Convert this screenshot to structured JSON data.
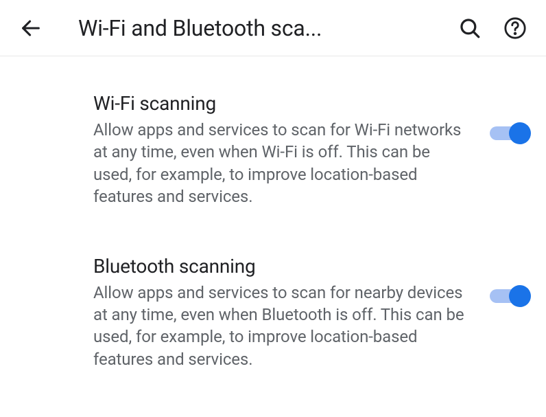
{
  "header": {
    "title": "Wi-Fi and Bluetooth sca..."
  },
  "settings": {
    "wifi": {
      "title": "Wi-Fi scanning",
      "description": "Allow apps and services to scan for Wi-Fi networks at any time, even when Wi-Fi is off. This can be used, for example, to improve location-based features and services.",
      "enabled": true
    },
    "bluetooth": {
      "title": "Bluetooth scanning",
      "description": "Allow apps and services to scan for nearby devices at any time, even when Bluetooth is off. This can be used, for example, to improve location-based features and services.",
      "enabled": true
    }
  }
}
